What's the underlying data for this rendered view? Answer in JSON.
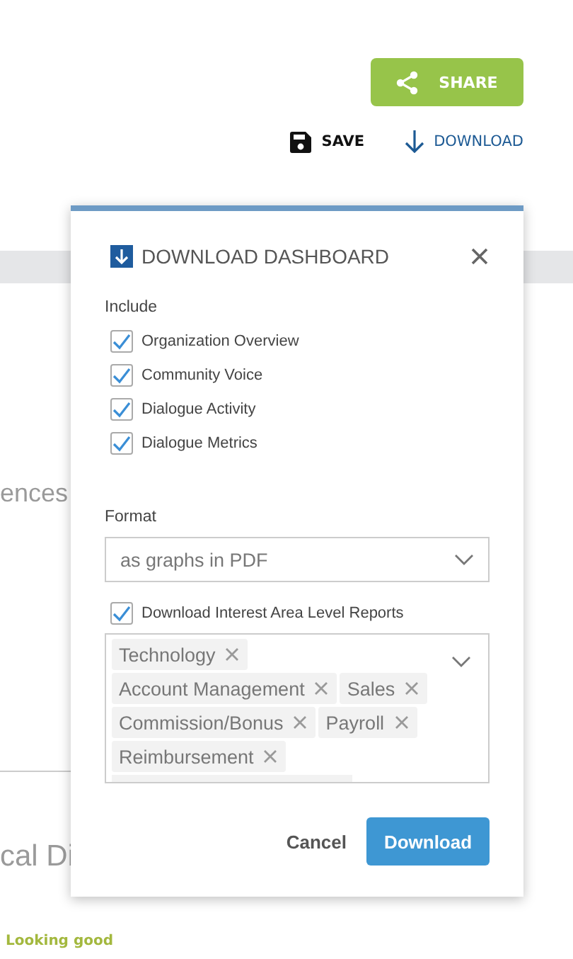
{
  "header": {
    "share_button": "SHARE"
  },
  "toolbar": {
    "save": "SAVE",
    "download": "DOWNLOAD"
  },
  "background": {
    "heading_fragment": "ences",
    "section_fragment": "cal Di",
    "status": "Looking good"
  },
  "dialog": {
    "title": "DOWNLOAD DASHBOARD",
    "include_label": "Include",
    "include_items": [
      {
        "label": "Organization Overview",
        "checked": true
      },
      {
        "label": "Community Voice",
        "checked": true
      },
      {
        "label": "Dialogue Activity",
        "checked": true
      },
      {
        "label": "Dialogue Metrics",
        "checked": true
      }
    ],
    "format_label": "Format",
    "format_value": "as graphs in PDF",
    "interest_option": {
      "label": "Download Interest Area Level Reports",
      "checked": true
    },
    "interest_tags": [
      "Technology",
      "Account Management",
      "Sales",
      "Commission/Bonus",
      "Payroll",
      "Reimbursement"
    ],
    "buttons": {
      "cancel": "Cancel",
      "confirm": "Download"
    }
  }
}
